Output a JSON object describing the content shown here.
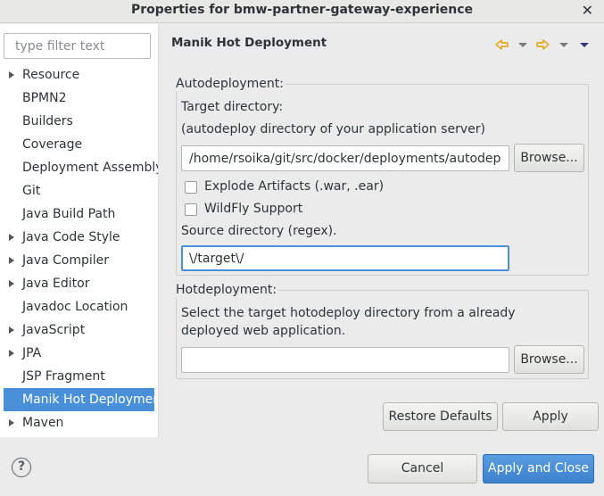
{
  "window": {
    "title": "Properties for bmw-partner-gateway-experience",
    "close_glyph": "✕"
  },
  "filter": {
    "placeholder": "type filter text"
  },
  "tree": [
    {
      "label": "Resource",
      "expandable": true
    },
    {
      "label": "BPMN2",
      "expandable": false
    },
    {
      "label": "Builders",
      "expandable": false
    },
    {
      "label": "Coverage",
      "expandable": false
    },
    {
      "label": "Deployment Assembly",
      "expandable": false
    },
    {
      "label": "Git",
      "expandable": false
    },
    {
      "label": "Java Build Path",
      "expandable": false
    },
    {
      "label": "Java Code Style",
      "expandable": true
    },
    {
      "label": "Java Compiler",
      "expandable": true
    },
    {
      "label": "Java Editor",
      "expandable": true
    },
    {
      "label": "Javadoc Location",
      "expandable": false
    },
    {
      "label": "JavaScript",
      "expandable": true
    },
    {
      "label": "JPA",
      "expandable": true
    },
    {
      "label": "JSP Fragment",
      "expandable": false
    },
    {
      "label": "Manik Hot Deployment",
      "expandable": false,
      "selected": true
    },
    {
      "label": "Maven",
      "expandable": true
    }
  ],
  "page": {
    "title": "Manik Hot Deployment",
    "autodeploy": {
      "group_label": "Autodeployment:",
      "target_label": "Target directory:",
      "target_hint": "(autodeploy directory of your application server)",
      "target_value": "/home/rsoika/git/src/docker/deployments/autodeploy",
      "browse_label": "Browse...",
      "explode_label": "Explode Artifacts (.war, .ear)",
      "explode_checked": false,
      "wildfly_label": "WildFly Support",
      "wildfly_checked": false,
      "source_label": "Source directory (regex).",
      "source_value": "\\/target\\/"
    },
    "hotdeploy": {
      "group_label": "Hotdeployment:",
      "hint_line1": "Select the target hotodeploy directory from a already",
      "hint_line2": "deployed web application.",
      "value": "",
      "browse_label": "Browse..."
    },
    "restore_defaults": "Restore Defaults",
    "apply": "Apply"
  },
  "footer": {
    "help_glyph": "?",
    "cancel": "Cancel",
    "apply_close": "Apply and Close"
  },
  "colors": {
    "accent": "#4a90d9",
    "nav_arrow": "#e8a000"
  }
}
